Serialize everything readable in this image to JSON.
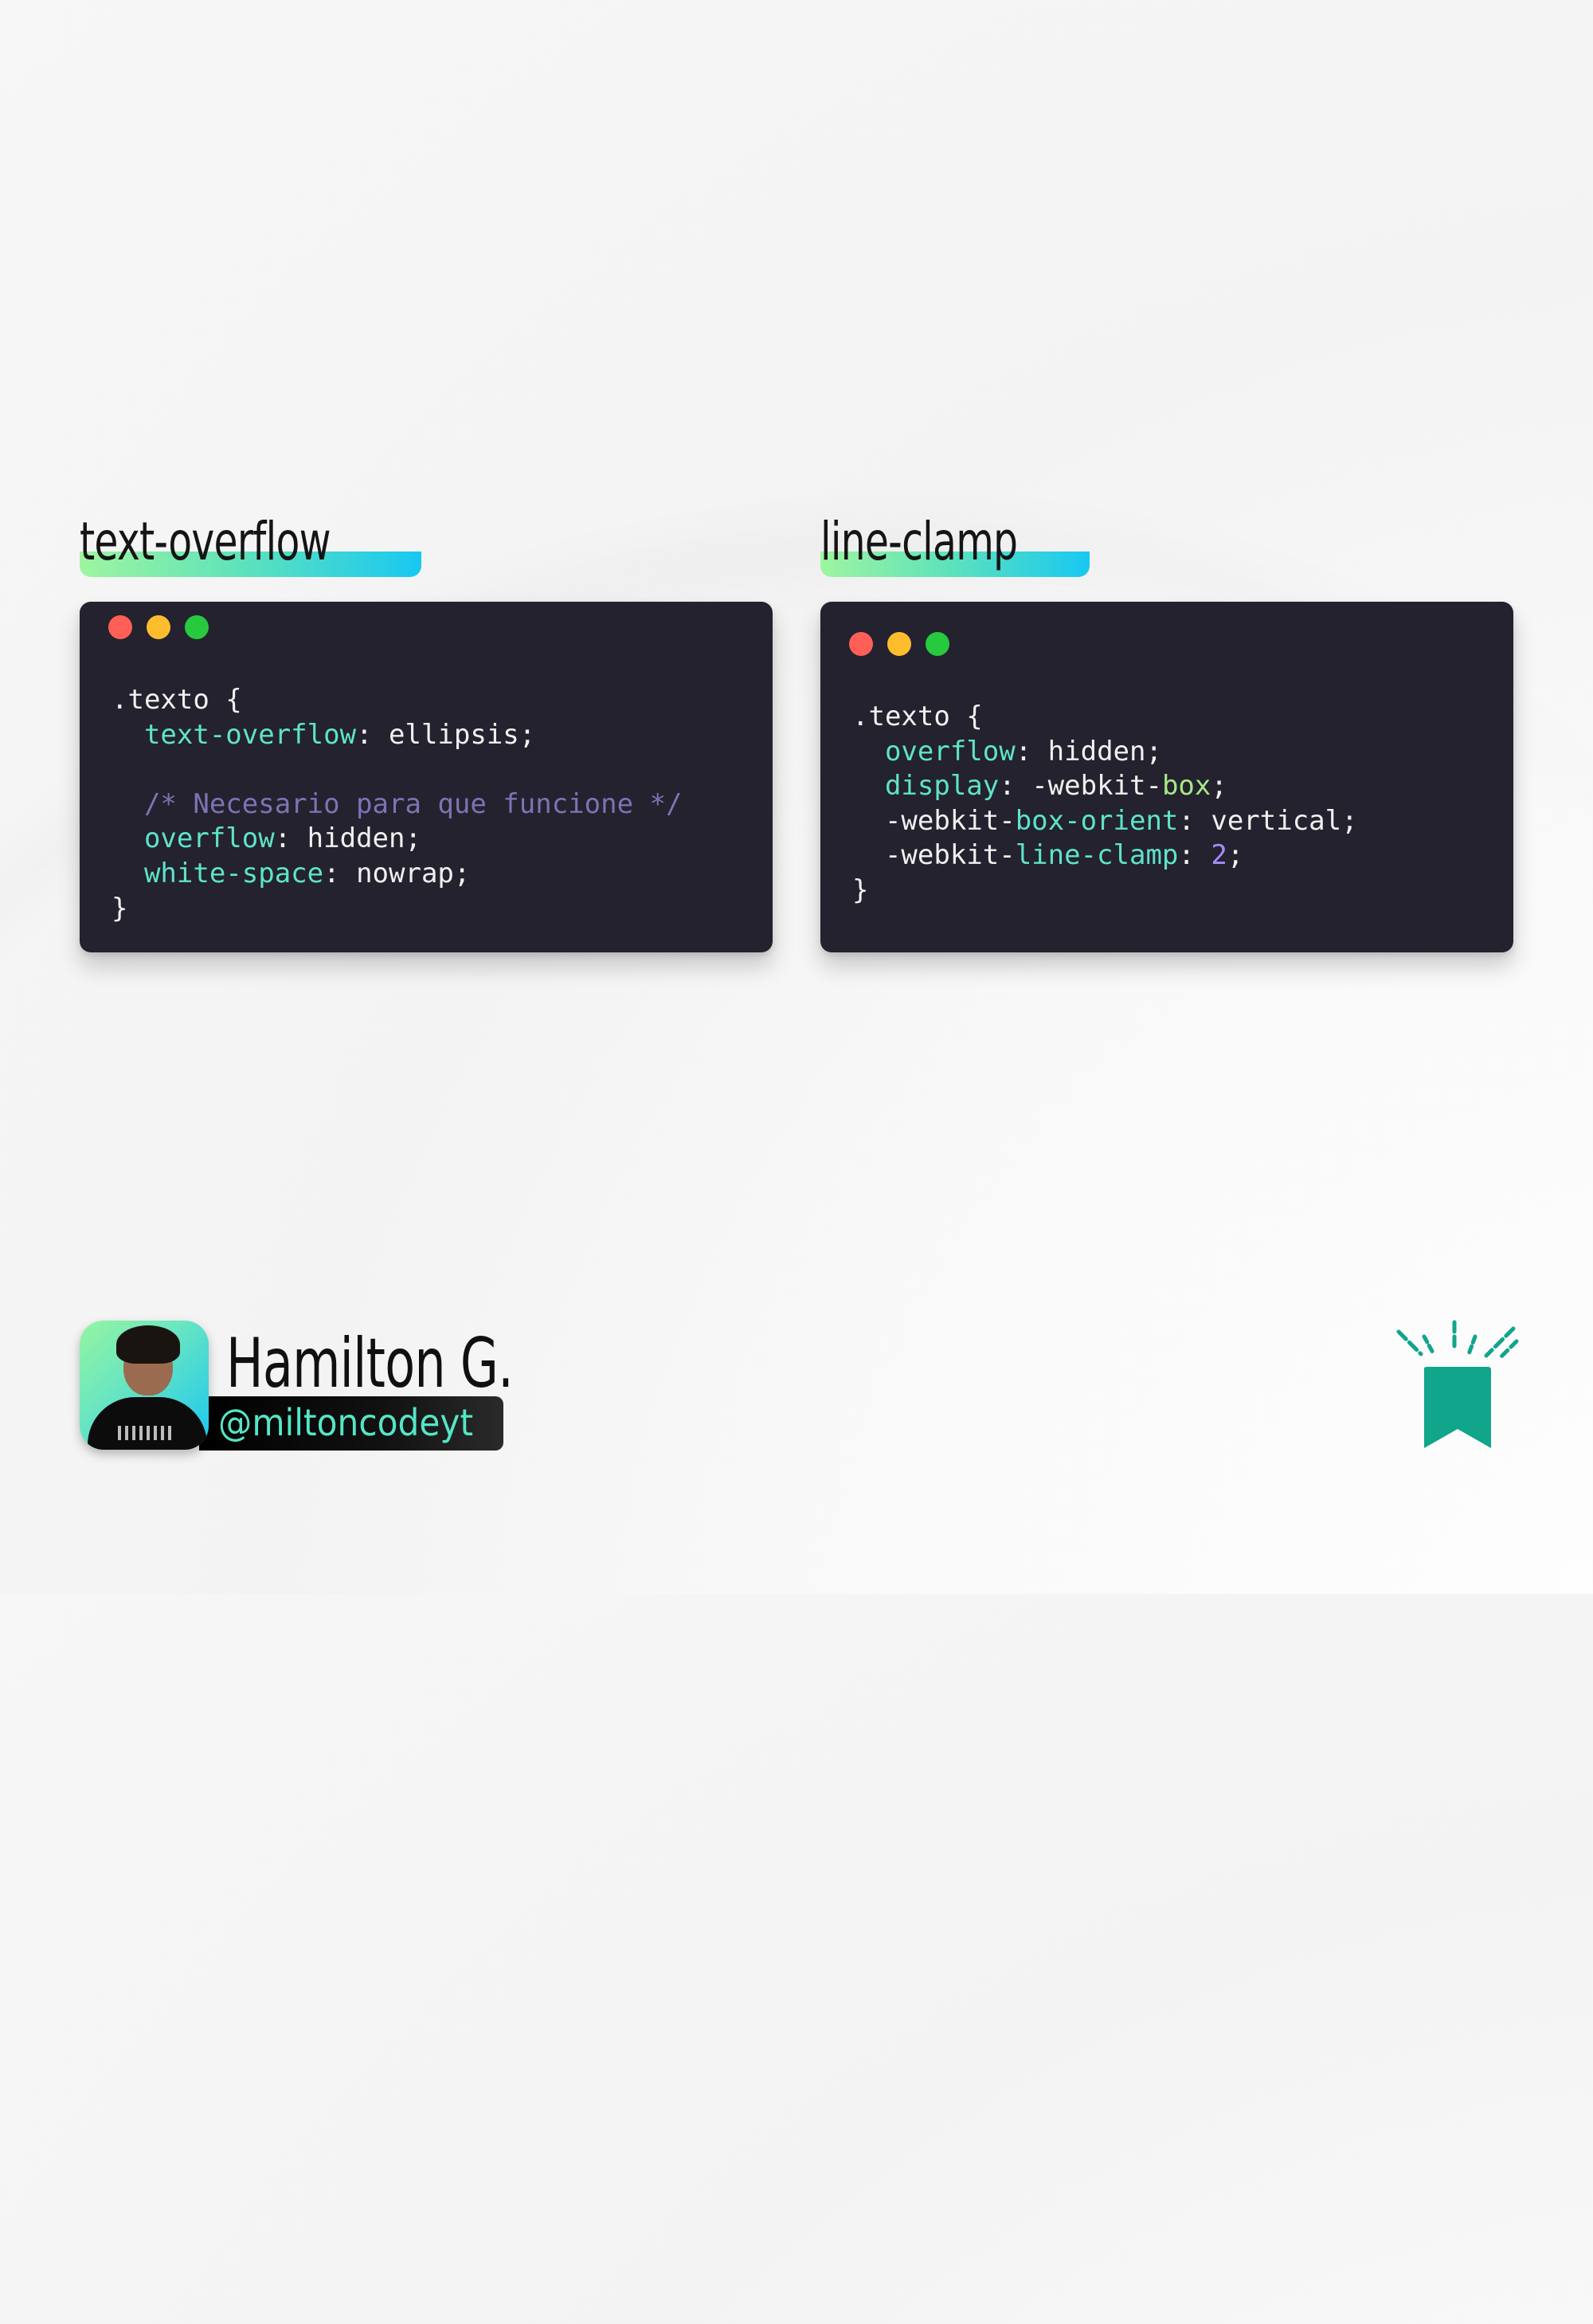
{
  "colors": {
    "accent_gradient_start": "#9ef5a0",
    "accent_gradient_end": "#18c8f2",
    "code_bg": "#23222e",
    "property": "#5fe3c8",
    "comment": "#7d73b3",
    "value_green": "#a5e887",
    "number": "#a78bfa",
    "dot_red": "#ff5f56",
    "dot_yellow": "#ffbd2e",
    "dot_green": "#27c93f",
    "bookmark": "#11a58b",
    "handle": "#54e6c6"
  },
  "panels": [
    {
      "title": "text-overflow",
      "code_lines": [
        [
          {
            "t": ".texto {",
            "c": ""
          }
        ],
        [
          {
            "t": "  ",
            "c": ""
          },
          {
            "t": "text-overflow",
            "c": "prop"
          },
          {
            "t": ": ellipsis;",
            "c": ""
          }
        ],
        [
          {
            "t": "",
            "c": ""
          }
        ],
        [
          {
            "t": "  ",
            "c": ""
          },
          {
            "t": "/* Necesario para que funcione */",
            "c": "comment"
          }
        ],
        [
          {
            "t": "  ",
            "c": ""
          },
          {
            "t": "overflow",
            "c": "prop"
          },
          {
            "t": ": hidden;",
            "c": ""
          }
        ],
        [
          {
            "t": "  ",
            "c": ""
          },
          {
            "t": "white-space",
            "c": "prop"
          },
          {
            "t": ": nowrap;",
            "c": ""
          }
        ],
        [
          {
            "t": "}",
            "c": ""
          }
        ]
      ]
    },
    {
      "title": "line-clamp",
      "code_lines": [
        [
          {
            "t": ".texto {",
            "c": ""
          }
        ],
        [
          {
            "t": "  ",
            "c": ""
          },
          {
            "t": "overflow",
            "c": "prop"
          },
          {
            "t": ": hidden;",
            "c": ""
          }
        ],
        [
          {
            "t": "  ",
            "c": ""
          },
          {
            "t": "display",
            "c": "prop"
          },
          {
            "t": ": -webkit-",
            "c": ""
          },
          {
            "t": "box",
            "c": "green"
          },
          {
            "t": ";",
            "c": ""
          }
        ],
        [
          {
            "t": "  -webkit-",
            "c": ""
          },
          {
            "t": "box-orient",
            "c": "prop"
          },
          {
            "t": ": vertical;",
            "c": ""
          }
        ],
        [
          {
            "t": "  -webkit-",
            "c": ""
          },
          {
            "t": "line-clamp",
            "c": "prop"
          },
          {
            "t": ": ",
            "c": ""
          },
          {
            "t": "2",
            "c": "num"
          },
          {
            "t": ";",
            "c": ""
          }
        ],
        [
          {
            "t": "}",
            "c": ""
          }
        ]
      ]
    }
  ],
  "author": {
    "name": "Hamilton G.",
    "handle": "@miltoncodeyt"
  },
  "icons": {
    "window_controls": [
      "close-dot",
      "minimize-dot",
      "maximize-dot"
    ],
    "save": "bookmark-icon"
  }
}
